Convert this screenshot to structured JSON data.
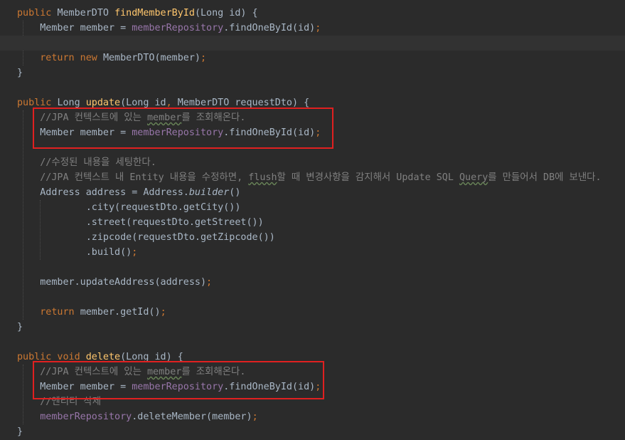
{
  "editor": {
    "lines": [
      {
        "tokens": [
          [
            "keyword",
            "public "
          ],
          [
            "type",
            "MemberDTO "
          ],
          [
            "method",
            "findMemberById"
          ],
          [
            "plain",
            "(Long id) {"
          ]
        ]
      },
      {
        "tokens": [
          [
            "space",
            "    "
          ],
          [
            "type",
            "Member member = "
          ],
          [
            "field",
            "memberRepository"
          ],
          [
            "plain",
            ".findOneById(id)"
          ],
          [
            "punct",
            ";"
          ]
        ]
      },
      {
        "current": true,
        "tokens": []
      },
      {
        "tokens": [
          [
            "space",
            "    "
          ],
          [
            "keyword",
            "return new "
          ],
          [
            "plain",
            "MemberDTO(member)"
          ],
          [
            "punct",
            ";"
          ]
        ]
      },
      {
        "tokens": [
          [
            "plain",
            "}"
          ]
        ]
      },
      {
        "tokens": []
      },
      {
        "tokens": [
          [
            "keyword",
            "public "
          ],
          [
            "type",
            "Long "
          ],
          [
            "method",
            "update"
          ],
          [
            "plain",
            "(Long id"
          ],
          [
            "punct",
            ", "
          ],
          [
            "plain",
            "MemberDTO requestDto) {"
          ]
        ]
      },
      {
        "tokens": [
          [
            "space",
            "    "
          ],
          [
            "comment",
            "//JPA 컨텍스트에 있는 "
          ],
          [
            "comment-typo",
            "member"
          ],
          [
            "comment",
            "를 조회해온다."
          ]
        ]
      },
      {
        "tokens": [
          [
            "space",
            "    "
          ],
          [
            "type",
            "Member member = "
          ],
          [
            "field",
            "memberRepository"
          ],
          [
            "plain",
            ".findOneById(id)"
          ],
          [
            "punct",
            ";"
          ]
        ]
      },
      {
        "tokens": []
      },
      {
        "tokens": [
          [
            "space",
            "    "
          ],
          [
            "comment",
            "//수정된 내용을 세팅한다."
          ]
        ]
      },
      {
        "tokens": [
          [
            "space",
            "    "
          ],
          [
            "comment",
            "//JPA 컨텍스트 내 Entity 내용을 수정하면, "
          ],
          [
            "comment-typo",
            "flush"
          ],
          [
            "comment",
            "할 때 변경사항을 감지해서 Update SQL "
          ],
          [
            "comment-typo",
            "Query"
          ],
          [
            "comment",
            "를 만들어서 DB에 보낸다."
          ]
        ]
      },
      {
        "tokens": [
          [
            "space",
            "    "
          ],
          [
            "type",
            "Address address = Address."
          ],
          [
            "italic",
            "builder"
          ],
          [
            "plain",
            "()"
          ]
        ]
      },
      {
        "tokens": [
          [
            "space",
            "            "
          ],
          [
            "plain",
            ".city(requestDto.getCity())"
          ]
        ]
      },
      {
        "tokens": [
          [
            "space",
            "            "
          ],
          [
            "plain",
            ".street(requestDto.getStreet())"
          ]
        ]
      },
      {
        "tokens": [
          [
            "space",
            "            "
          ],
          [
            "plain",
            ".zipcode(requestDto.getZipcode())"
          ]
        ]
      },
      {
        "tokens": [
          [
            "space",
            "            "
          ],
          [
            "plain",
            ".build()"
          ],
          [
            "punct",
            ";"
          ]
        ]
      },
      {
        "tokens": []
      },
      {
        "tokens": [
          [
            "space",
            "    "
          ],
          [
            "plain",
            "member.updateAddress(address)"
          ],
          [
            "punct",
            ";"
          ]
        ]
      },
      {
        "tokens": []
      },
      {
        "tokens": [
          [
            "space",
            "    "
          ],
          [
            "keyword",
            "return "
          ],
          [
            "plain",
            "member.getId()"
          ],
          [
            "punct",
            ";"
          ]
        ]
      },
      {
        "tokens": [
          [
            "plain",
            "}"
          ]
        ]
      },
      {
        "tokens": []
      },
      {
        "tokens": [
          [
            "keyword",
            "public void "
          ],
          [
            "method",
            "delete"
          ],
          [
            "plain",
            "(Long id) {"
          ]
        ]
      },
      {
        "tokens": [
          [
            "space",
            "    "
          ],
          [
            "comment",
            "//JPA 컨텍스트에 있는 "
          ],
          [
            "comment-typo",
            "member"
          ],
          [
            "comment",
            "를 조회해온다."
          ]
        ]
      },
      {
        "tokens": [
          [
            "space",
            "    "
          ],
          [
            "type",
            "Member member = "
          ],
          [
            "field",
            "memberRepository"
          ],
          [
            "plain",
            ".findOneById(id)"
          ],
          [
            "punct",
            ";"
          ]
        ]
      },
      {
        "tokens": [
          [
            "space",
            "    "
          ],
          [
            "comment",
            "//엔티티 삭제"
          ]
        ]
      },
      {
        "tokens": [
          [
            "space",
            "    "
          ],
          [
            "field",
            "memberRepository"
          ],
          [
            "plain",
            ".deleteMember(member)"
          ],
          [
            "punct",
            ";"
          ]
        ]
      },
      {
        "tokens": [
          [
            "plain",
            "}"
          ]
        ]
      }
    ]
  },
  "colors": {
    "background": "#2b2b2b",
    "current_line": "#323232",
    "keyword": "#cc7832",
    "method": "#ffc66d",
    "field": "#9876aa",
    "comment": "#808080",
    "text": "#a9b7c6",
    "highlight_box": "#e02020"
  }
}
